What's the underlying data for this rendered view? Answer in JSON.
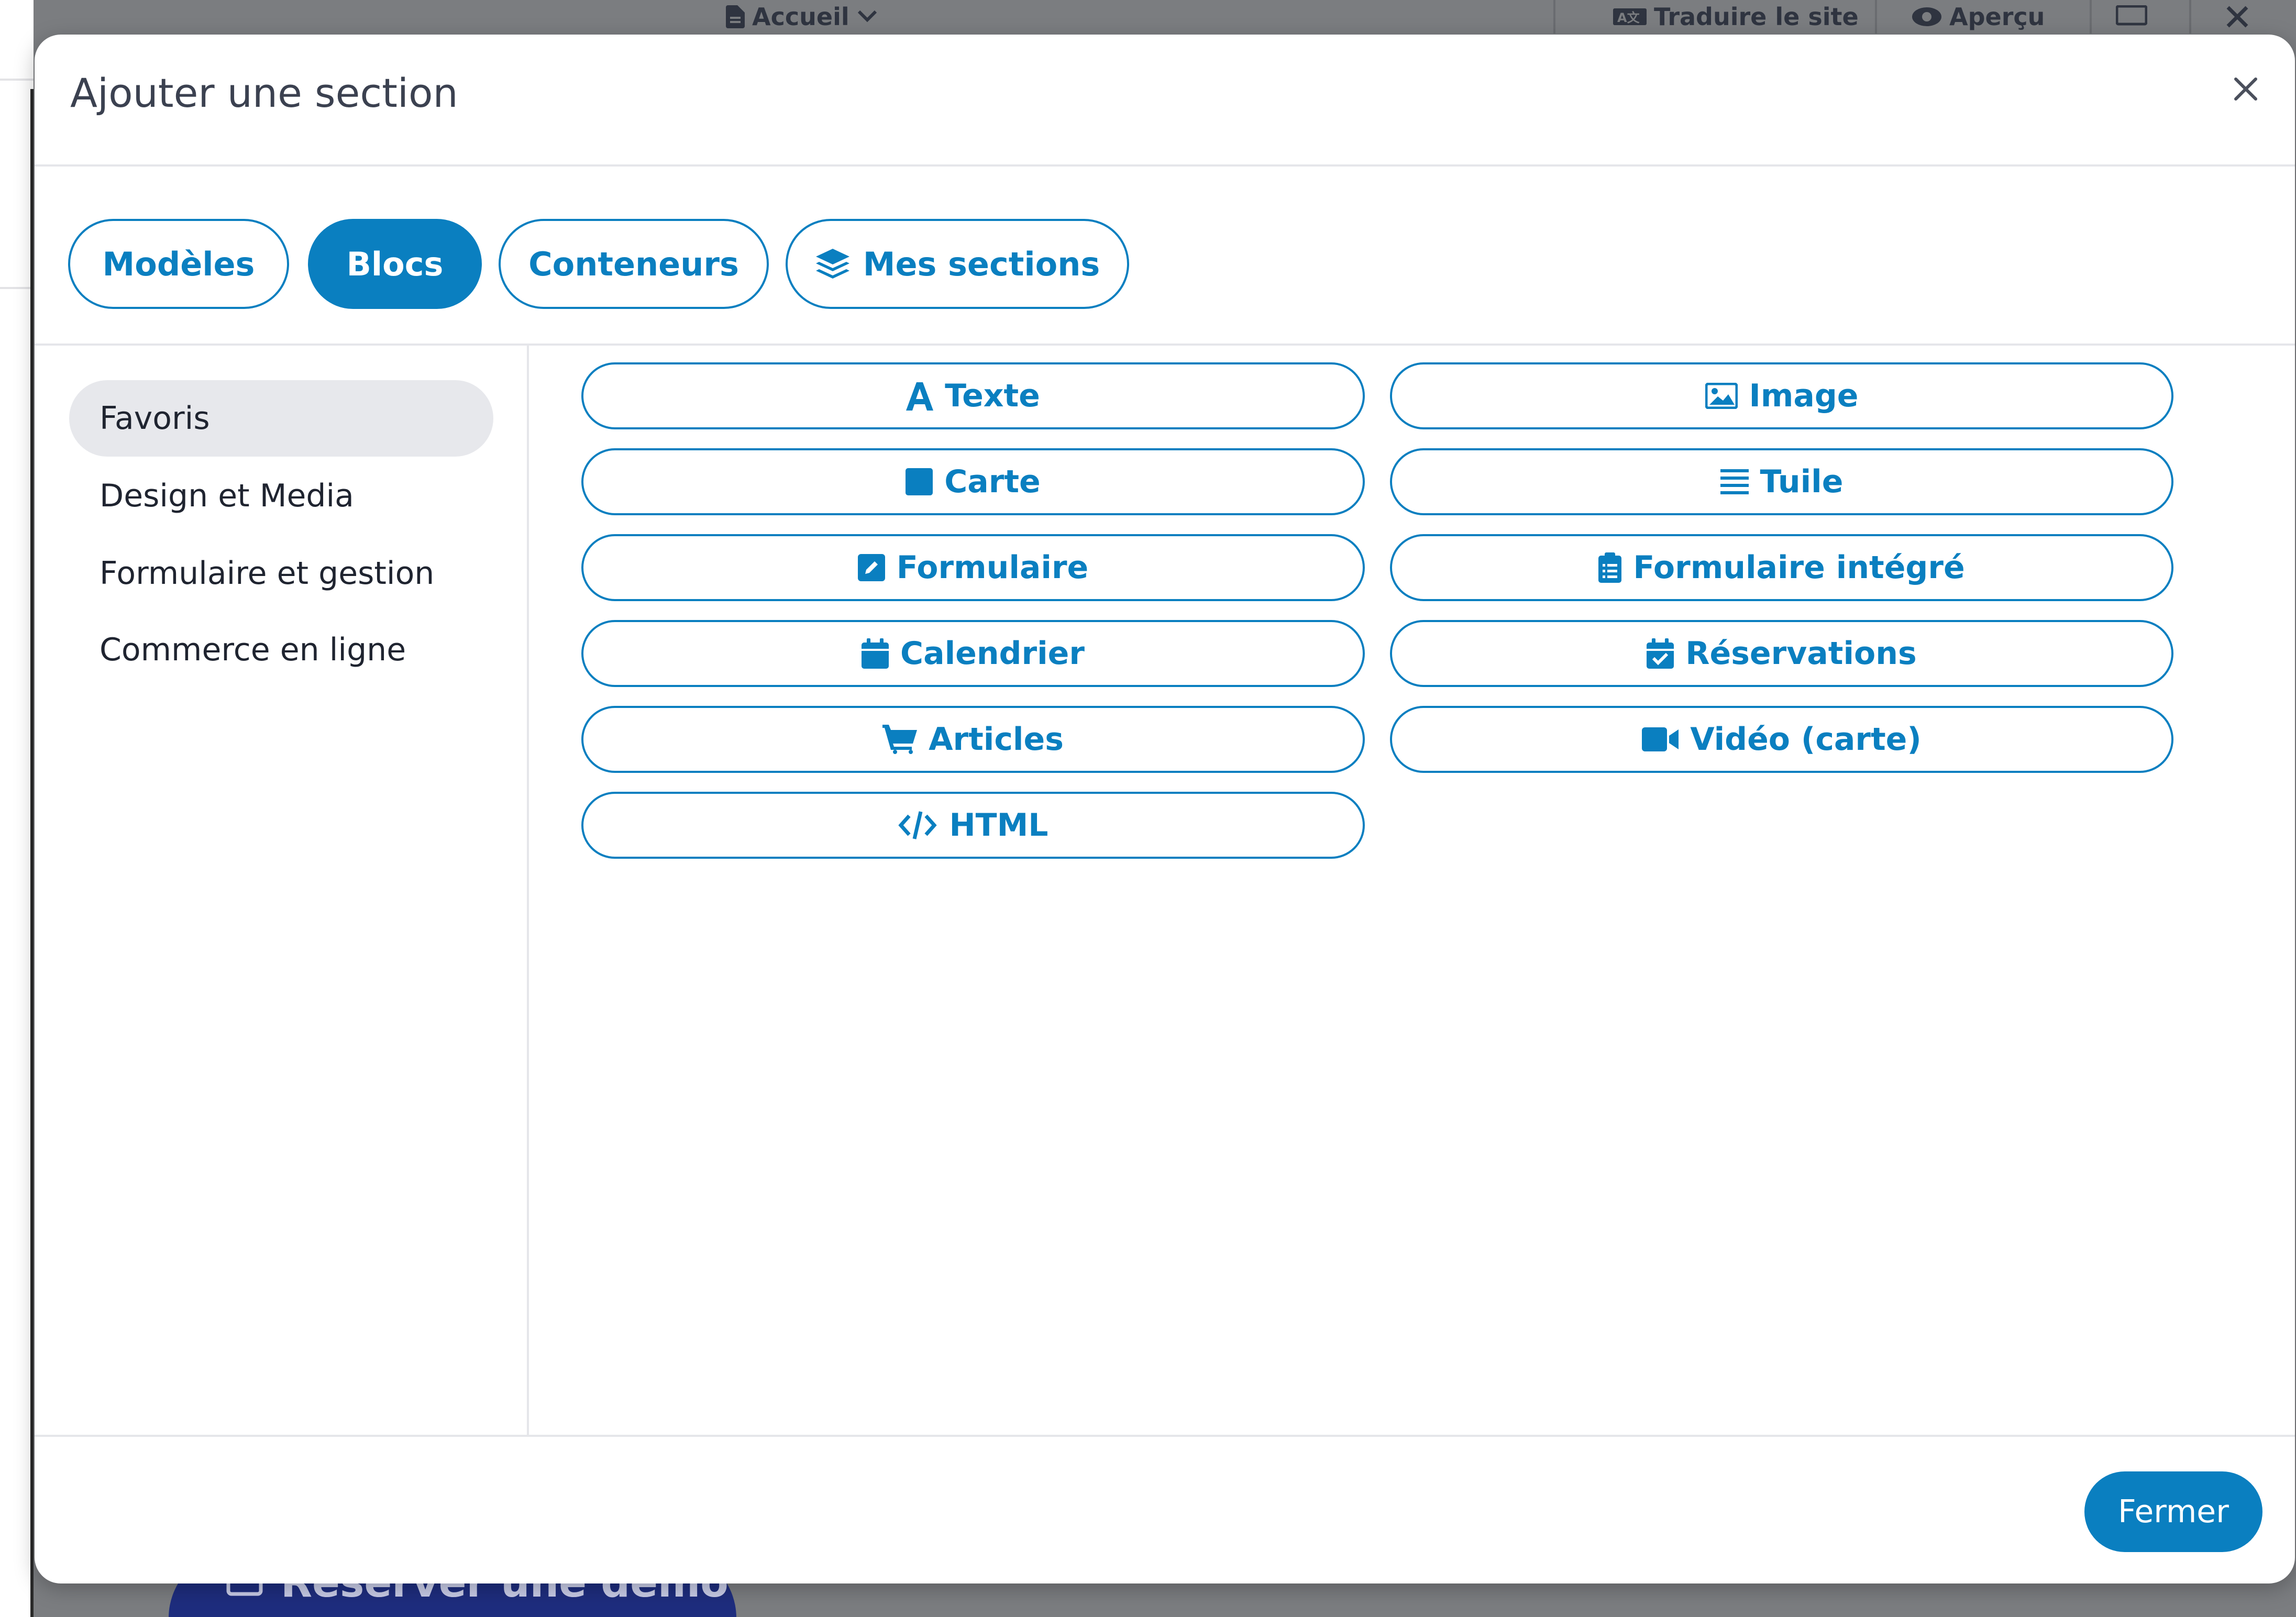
{
  "background_page": {
    "page_selector": {
      "label": "Accueil",
      "icon": "file-icon",
      "chevron": "chevron-down-icon"
    },
    "translate_button": {
      "label": "Traduire le site",
      "icon": "translate-icon"
    },
    "preview_button": {
      "label": "Aperçu",
      "icon": "eye-icon"
    },
    "device_icon": "monitor-icon",
    "close_icon": "close-icon",
    "demo_button": {
      "label": "Réserver une démo",
      "icon": "calendar-icon",
      "color": "#1e2d7e"
    }
  },
  "modal": {
    "title": "Ajouter une section",
    "close_icon": "close-icon",
    "tabs": [
      {
        "label": "Modèles",
        "active": false
      },
      {
        "label": "Blocs",
        "active": true
      },
      {
        "label": "Conteneurs",
        "active": false
      },
      {
        "label": "Mes sections",
        "active": false,
        "icon": "layers-icon"
      }
    ],
    "categories": [
      {
        "label": "Favoris",
        "active": true
      },
      {
        "label": "Design et Media",
        "active": false
      },
      {
        "label": "Formulaire et gestion",
        "active": false
      },
      {
        "label": "Commerce en ligne",
        "active": false
      }
    ],
    "blocks": [
      {
        "label": "Texte",
        "icon": "font-icon"
      },
      {
        "label": "Image",
        "icon": "image-icon"
      },
      {
        "label": "Carte",
        "icon": "square-icon"
      },
      {
        "label": "Tuile",
        "icon": "list-lines-icon"
      },
      {
        "label": "Formulaire",
        "icon": "edit-icon"
      },
      {
        "label": "Formulaire intégré",
        "icon": "clipboard-list-icon"
      },
      {
        "label": "Calendrier",
        "icon": "calendar-icon"
      },
      {
        "label": "Réservations",
        "icon": "calendar-check-icon"
      },
      {
        "label": "Articles",
        "icon": "cart-icon"
      },
      {
        "label": "Vidéo (carte)",
        "icon": "video-icon"
      },
      {
        "label": "HTML",
        "icon": "code-icon"
      }
    ],
    "footer": {
      "close_label": "Fermer"
    }
  },
  "colors": {
    "accent": "#0a7fc0",
    "overlay": "#7b7d80",
    "active_category_bg": "#e7e8ec",
    "text_dark": "#1f2430"
  }
}
